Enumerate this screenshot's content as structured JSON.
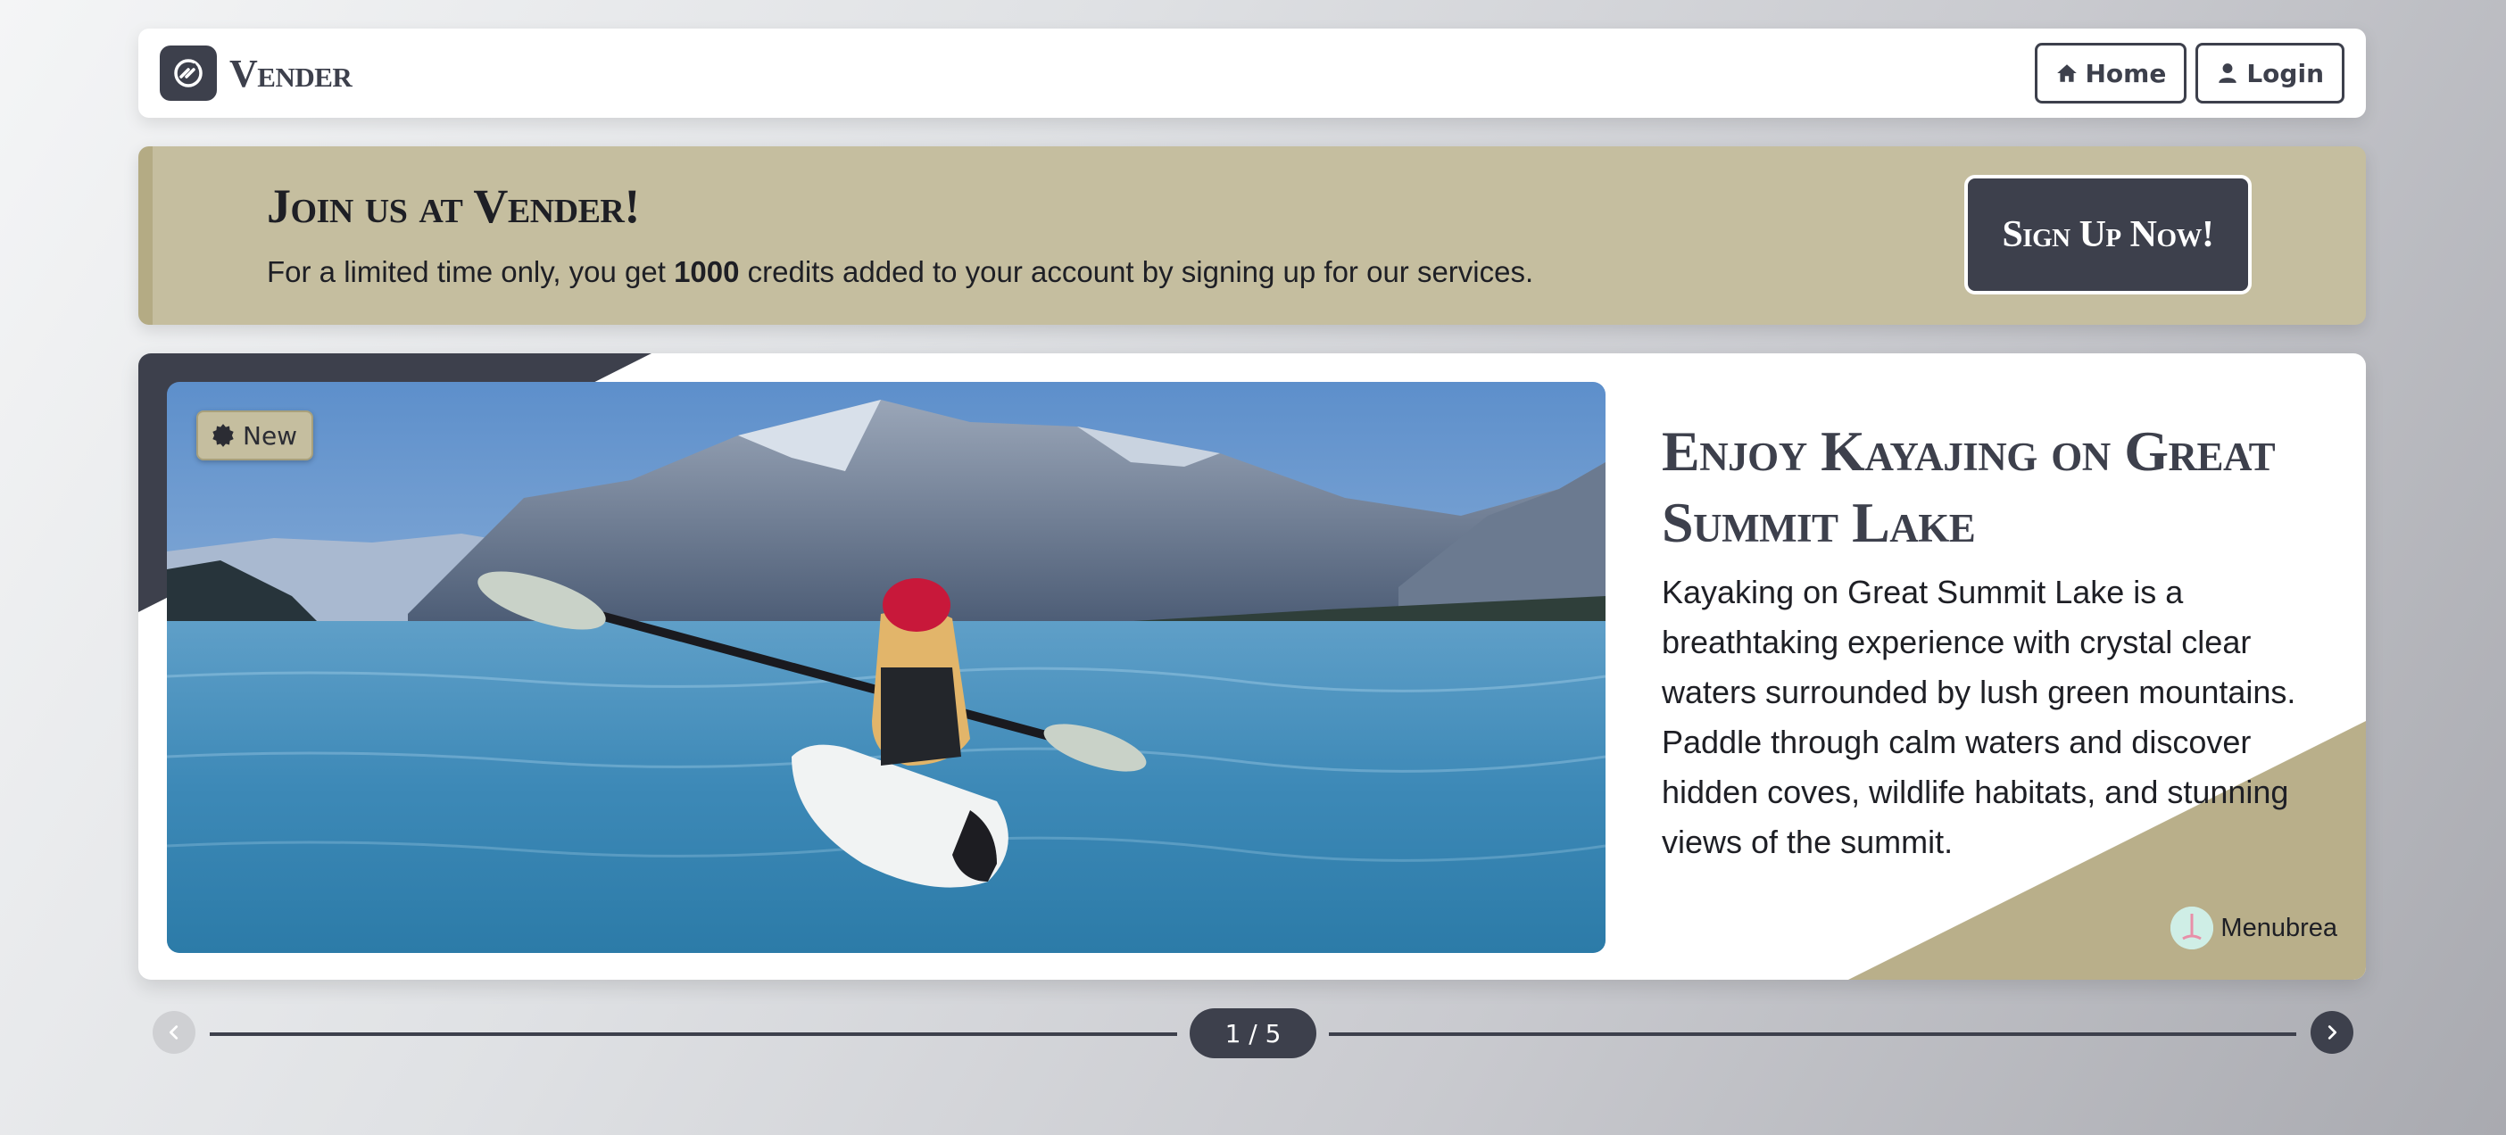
{
  "navbar": {
    "brand_name": "Vender",
    "home_label": "Home",
    "login_label": "Login"
  },
  "promo": {
    "title": "Join us at Vender!",
    "text_before": "For a limited time only, you get ",
    "credits": "1000",
    "text_after": " credits added to your account by signing up for our services.",
    "signup_label": "Sign Up Now!"
  },
  "card": {
    "badge_label": "New",
    "title": "Enjoy Kayajing on Great Summit Lake",
    "description": "Kayaking on Great Summit Lake is a breathtaking experience with crystal clear waters surrounded by lush green mountains. Paddle through calm waters and discover hidden coves, wildlife habitats, and stunning views of the summit.",
    "author": "Menubrea"
  },
  "pager": {
    "count": "1 / 5"
  },
  "colors": {
    "primary": "#3d404c",
    "accent": "#c5be9f",
    "accent_dark": "#b4ab84"
  },
  "icons": {
    "brand": "brand-logo-icon",
    "home": "home-icon",
    "login": "user-icon",
    "badge": "seal-icon",
    "prev": "chevron-left-icon",
    "next": "chevron-right-icon"
  }
}
